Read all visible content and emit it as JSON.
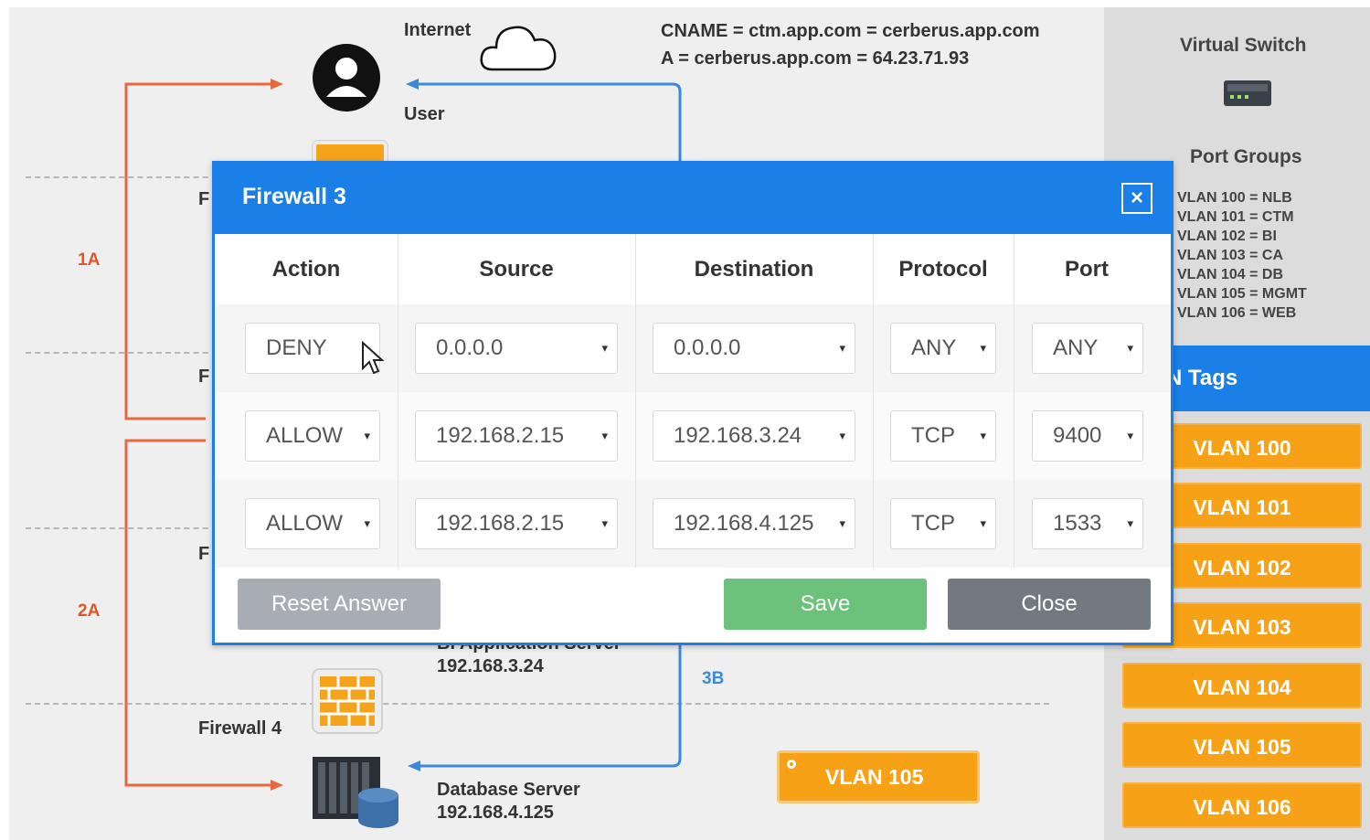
{
  "diagram": {
    "internet_label": "Internet",
    "dns_line1": "CNAME = ctm.app.com = cerberus.app.com",
    "dns_line2": "A = cerberus.app.com = 64.23.71.93",
    "user_label": "User",
    "label_1a": "1A",
    "label_2a": "2A",
    "label_3b": "3B",
    "app_server_name": "BI Application Server",
    "app_server_ip": "192.168.3.24",
    "firewall4_label": "Firewall 4",
    "db_server_name": "Database Server",
    "db_server_ip": "192.168.4.125",
    "vlan_badge": "VLAN 105",
    "fw_letter": "F",
    "colors": {
      "arrow_orange": "#e5693c",
      "arrow_blue": "#3b8ad8",
      "accent": "#1a7fe6",
      "vlan": "#f7a116"
    }
  },
  "virtual_switch": {
    "title": "Virtual Switch",
    "port_groups_title": "Port Groups",
    "port_groups": [
      "VLAN 100 = NLB",
      "VLAN 101 = CTM",
      "VLAN 102 = BI",
      "VLAN 103 = CA",
      "VLAN 104 = DB",
      "VLAN 105 = MGMT",
      "VLAN 106 = WEB"
    ],
    "vlan_tags_title": "VLAN Tags",
    "vlan_tags_visible": "N Tags",
    "vlan_tags": [
      "VLAN 100",
      "VLAN 101",
      "VLAN 102",
      "VLAN 103",
      "VLAN 104",
      "VLAN 105",
      "VLAN 106"
    ]
  },
  "modal": {
    "title": "Firewall 3",
    "close_icon": "×",
    "columns": [
      "Action",
      "Source",
      "Destination",
      "Protocol",
      "Port"
    ],
    "rows": [
      {
        "action": "DENY",
        "source": "0.0.0.0",
        "destination": "0.0.0.0",
        "protocol": "ANY",
        "port": "ANY"
      },
      {
        "action": "ALLOW",
        "source": "192.168.2.15",
        "destination": "192.168.3.24",
        "protocol": "TCP",
        "port": "9400"
      },
      {
        "action": "ALLOW",
        "source": "192.168.2.15",
        "destination": "192.168.4.125",
        "protocol": "TCP",
        "port": "1533"
      }
    ],
    "reset_label": "Reset Answer",
    "save_label": "Save",
    "close_label": "Close",
    "caret": "▾"
  }
}
